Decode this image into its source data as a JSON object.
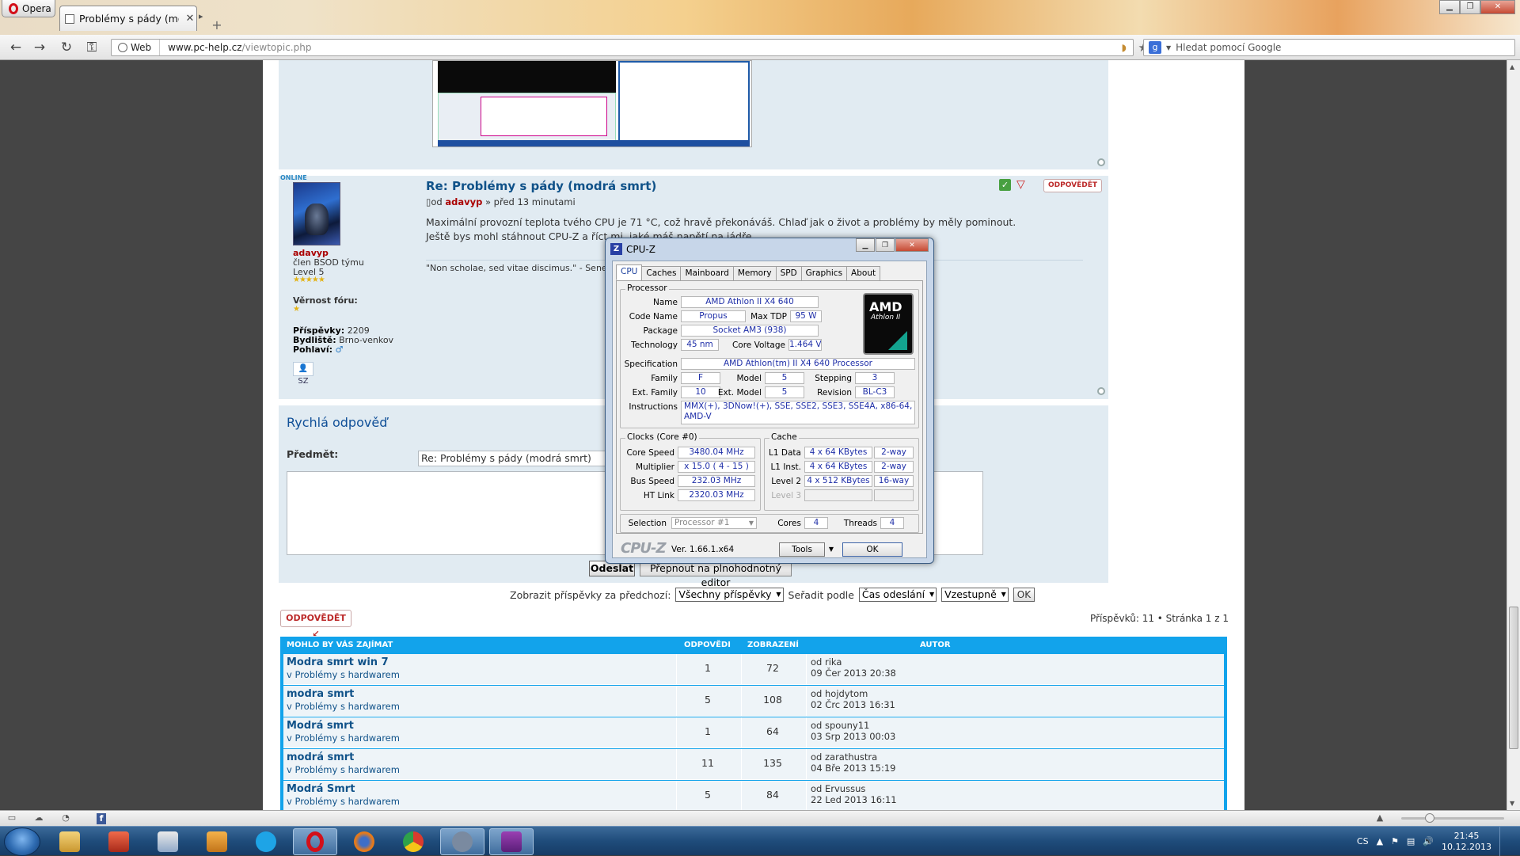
{
  "browser": {
    "menu_label": "Opera",
    "tab_title": "Problémy s pády (mo...",
    "web_label": "Web",
    "url_host": "www.pc-help.cz",
    "url_path": "/viewtopic.php",
    "search_placeholder": "Hledat pomocí Google"
  },
  "post2": {
    "online": "ONLINE",
    "title": "Re: Problémy s pády (modrá smrt)",
    "meta_prefix": "od",
    "author": "adavyp",
    "meta_suffix": "» před 13 minutami",
    "body_line1": "Maximální provozní teplota tvého CPU je 71 °C, což hravě překonáváš. Chlaď jak o život a problémy by měly pominout.",
    "body_line2": "Ještě bys mohl stáhnout CPU-Z a říct mi, jaké máš napětí na jádře.",
    "signature": "\"Non scholae, sed vitae discimus.\" - Seneca",
    "reply_label": "ODPOVĚDĚT",
    "profile": {
      "username": "adavyp",
      "rank": "člen BSOD týmu",
      "level": "Level 5",
      "loyalty_label": "Věrnost fóru:",
      "posts_label": "Příspěvky:",
      "posts_value": "2209",
      "location_label": "Bydliště:",
      "location_value": "Brno-venkov",
      "gender_label": "Pohlaví:",
      "sz_label": "SZ"
    }
  },
  "quick_reply": {
    "title": "Rychlá odpověď",
    "subject_label": "Předmět:",
    "subject_value": "Re: Problémy s pády (modrá smrt)",
    "send_label": "Odeslat",
    "full_editor_label": "Přepnout na plnohodnotný editor"
  },
  "sort": {
    "show_label": "Zobrazit příspěvky za předchozí:",
    "show_value": "Všechny příspěvky",
    "order_label": "Seřadit podle",
    "order_value": "Čas odeslání",
    "dir_value": "Vzestupně",
    "ok_label": "OK"
  },
  "reply_button": "ODPOVĚDĚT",
  "pagination": "Příspěvků: 11 • Stránka 1 z 1",
  "related": {
    "header_title": "MOHLO BY VÁS ZAJÍMAT",
    "header_replies": "ODPOVĚDI",
    "header_views": "ZOBRAZENÍ",
    "header_author": "AUTOR",
    "rows": [
      {
        "title": "Modra smrt win 7",
        "forum": "v Problémy s hardwarem",
        "replies": "1",
        "views": "72",
        "by": "od rika",
        "date": "09 Čer 2013 20:38"
      },
      {
        "title": "modra smrt",
        "forum": "v Problémy s hardwarem",
        "replies": "5",
        "views": "108",
        "by": "od hojdytom",
        "date": "02 Črc 2013 16:31"
      },
      {
        "title": "Modrá smrt",
        "forum": "v Problémy s hardwarem",
        "replies": "1",
        "views": "64",
        "by": "od spouny11",
        "date": "03 Srp 2013 00:03"
      },
      {
        "title": "modrá smrt",
        "forum": "v Problémy s hardwarem",
        "replies": "11",
        "views": "135",
        "by": "od zarathustra",
        "date": "04 Bře 2013 15:19"
      },
      {
        "title": "Modrá Smrt",
        "forum": "v Problémy s hardwarem",
        "replies": "5",
        "views": "84",
        "by": "od Ervussus",
        "date": "22 Led 2013 16:11"
      }
    ]
  },
  "cpuz": {
    "title": "CPU-Z",
    "tabs": [
      "CPU",
      "Caches",
      "Mainboard",
      "Memory",
      "SPD",
      "Graphics",
      "About"
    ],
    "processor_group": "Processor",
    "name_label": "Name",
    "name": "AMD Athlon II X4 640",
    "codename_label": "Code Name",
    "codename": "Propus",
    "tdp_label": "Max TDP",
    "tdp": "95 W",
    "package_label": "Package",
    "package": "Socket AM3 (938)",
    "tech_label": "Technology",
    "tech": "45 nm",
    "voltage_label": "Core Voltage",
    "voltage": "1.464 V",
    "spec_label": "Specification",
    "spec": "AMD Athlon(tm) II X4 640 Processor",
    "family_label": "Family",
    "family": "F",
    "model_label": "Model",
    "model": "5",
    "stepping_label": "Stepping",
    "stepping": "3",
    "extfamily_label": "Ext. Family",
    "extfamily": "10",
    "extmodel_label": "Ext. Model",
    "extmodel": "5",
    "revision_label": "Revision",
    "revision": "BL-C3",
    "instr_label": "Instructions",
    "instr": "MMX(+), 3DNow!(+), SSE, SSE2, SSE3, SSE4A, x86-64, AMD-V",
    "clocks_group": "Clocks (Core #0)",
    "corespeed_label": "Core Speed",
    "corespeed": "3480.04 MHz",
    "mult_label": "Multiplier",
    "mult": "x 15.0 ( 4 - 15 )",
    "bus_label": "Bus Speed",
    "bus": "232.03 MHz",
    "ht_label": "HT Link",
    "ht": "2320.03 MHz",
    "cache_group": "Cache",
    "l1d_label": "L1 Data",
    "l1d": "4 x 64 KBytes",
    "l1d_way": "2-way",
    "l1i_label": "L1 Inst.",
    "l1i": "4 x 64 KBytes",
    "l1i_way": "2-way",
    "l2_label": "Level 2",
    "l2": "4 x 512 KBytes",
    "l2_way": "16-way",
    "l3_label": "Level 3",
    "selection_label": "Selection",
    "selection": "Processor #1",
    "cores_label": "Cores",
    "cores": "4",
    "threads_label": "Threads",
    "threads": "4",
    "footer_logo": "CPU-Z",
    "version": "Ver. 1.66.1.x64",
    "tools_label": "Tools",
    "ok_label": "OK",
    "amd_logo": "AMD",
    "amd_sub": "Athlon II"
  },
  "tray": {
    "lang": "CS",
    "time": "21:45",
    "date": "10.12.2013"
  },
  "colors": {
    "link_blue": "#105289",
    "post_bg": "#e1ebf2",
    "table_header": "#12a3eb",
    "reply_red": "#bc2a2a"
  }
}
